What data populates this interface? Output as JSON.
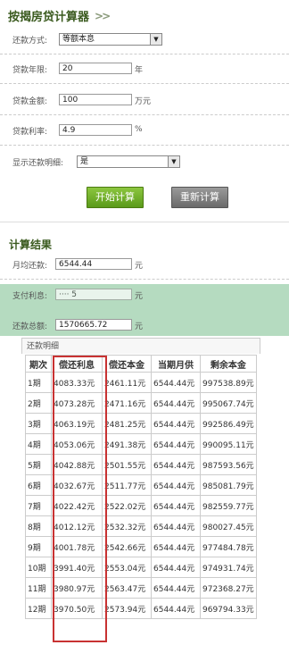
{
  "calculator": {
    "title": "按揭房贷计算器",
    "title_icon": "double-chevron-icon",
    "repayment_method_label": "还款方式:",
    "repayment_method_value": "等额本息",
    "loan_years_label": "贷款年限:",
    "loan_years_value": "20",
    "loan_years_unit": "年",
    "loan_amount_label": "贷款金额:",
    "loan_amount_value": "100",
    "loan_amount_unit": "万元",
    "rate_label": "贷款利率:",
    "rate_value": "4.9",
    "rate_unit": "%",
    "show_detail_label": "显示还款明细:",
    "show_detail_value": "是",
    "start_button": "开始计算",
    "reset_button": "重新计算"
  },
  "result": {
    "title": "计算结果",
    "monthly_label": "月均还款:",
    "monthly_value": "6544.44",
    "monthly_unit": "元",
    "interest_label": "支付利息:",
    "interest_value": "···· 5",
    "interest_unit": "元",
    "total_label": "还款总额:",
    "total_value": "1570665.72",
    "total_unit": "元"
  },
  "detail": {
    "header": "还款明细",
    "columns": [
      "期次",
      "偿还利息",
      "偿还本金",
      "当期月供",
      "剩余本金"
    ],
    "rows": [
      [
        "1期",
        "4083.33元",
        "2461.11元",
        "6544.44元",
        "997538.89元"
      ],
      [
        "2期",
        "4073.28元",
        "2471.16元",
        "6544.44元",
        "995067.74元"
      ],
      [
        "3期",
        "4063.19元",
        "2481.25元",
        "6544.44元",
        "992586.49元"
      ],
      [
        "4期",
        "4053.06元",
        "2491.38元",
        "6544.44元",
        "990095.11元"
      ],
      [
        "5期",
        "4042.88元",
        "2501.55元",
        "6544.44元",
        "987593.56元"
      ],
      [
        "6期",
        "4032.67元",
        "2511.77元",
        "6544.44元",
        "985081.79元"
      ],
      [
        "7期",
        "4022.42元",
        "2522.02元",
        "6544.44元",
        "982559.77元"
      ],
      [
        "8期",
        "4012.12元",
        "2532.32元",
        "6544.44元",
        "980027.45元"
      ],
      [
        "9期",
        "4001.78元",
        "2542.66元",
        "6544.44元",
        "977484.78元"
      ],
      [
        "10期",
        "3991.40元",
        "2553.04元",
        "6544.44元",
        "974931.74元"
      ],
      [
        "11期",
        "3980.97元",
        "2563.47元",
        "6544.44元",
        "972368.27元"
      ],
      [
        "12期",
        "3970.50元",
        "2573.94元",
        "6544.44元",
        "969794.33元"
      ]
    ]
  }
}
